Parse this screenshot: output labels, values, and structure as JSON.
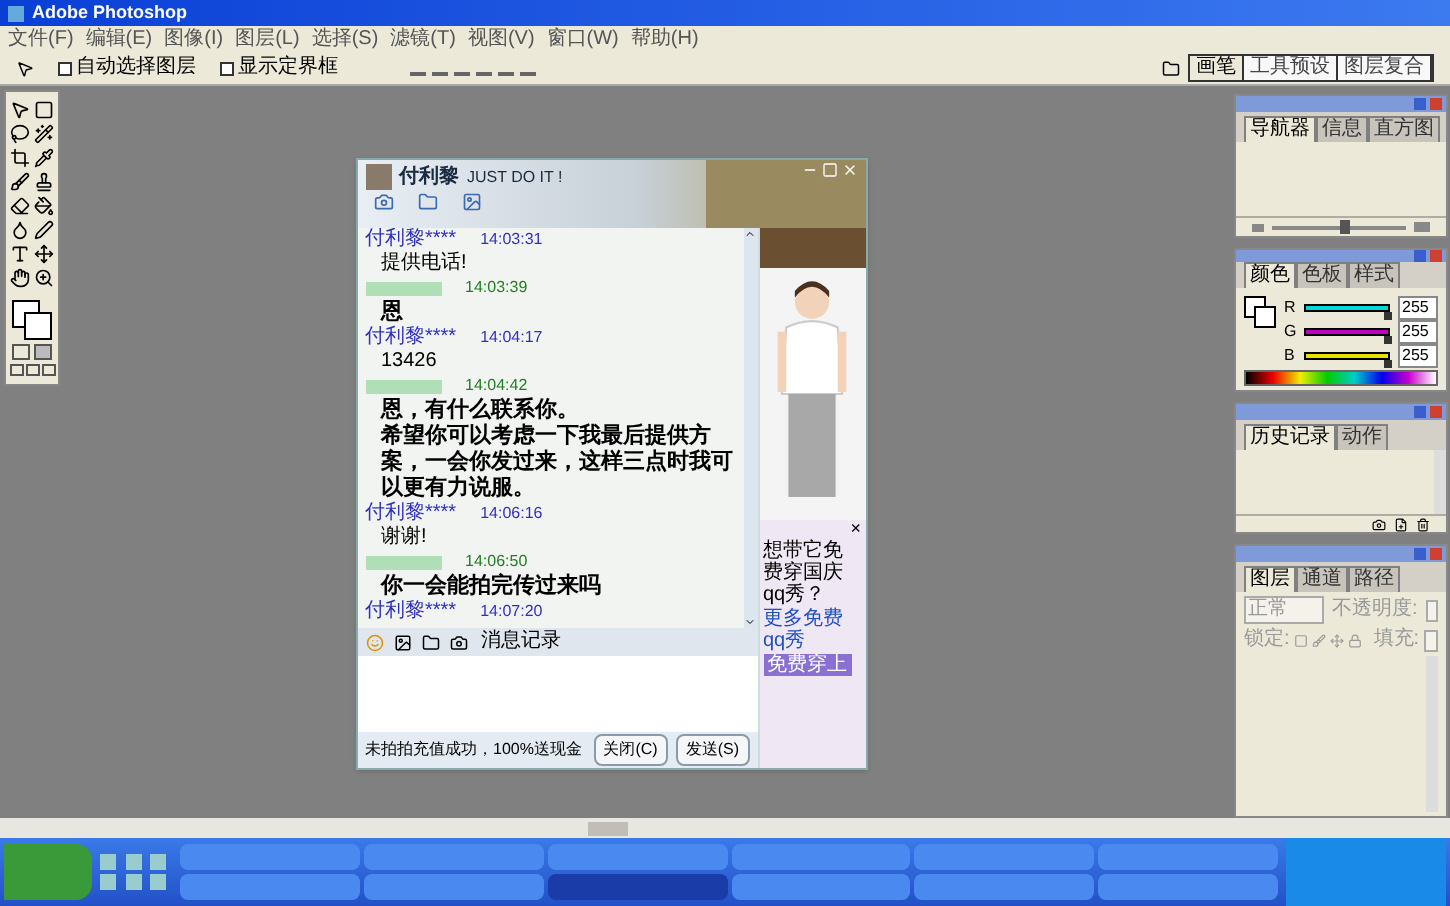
{
  "window": {
    "title": "Adobe Photoshop"
  },
  "menu": [
    "文件(F)",
    "编辑(E)",
    "图像(I)",
    "图层(L)",
    "选择(S)",
    "滤镜(T)",
    "视图(V)",
    "窗口(W)",
    "帮助(H)"
  ],
  "options_bar": {
    "checkboxes": [
      {
        "label": "自动选择图层",
        "checked": false
      },
      {
        "label": "显示定界框",
        "checked": false
      }
    ],
    "palette_tabs": [
      {
        "label": "画笔",
        "selected": true
      },
      {
        "label": "工具预设",
        "selected": false
      },
      {
        "label": "图层复合",
        "selected": false
      }
    ]
  },
  "chat": {
    "contact_name": "付利黎",
    "signature": "JUST DO IT !",
    "messages": [
      {
        "kind": "contact",
        "sender": "付利黎****",
        "time": "14:03:31",
        "lines": [
          "提供电话!"
        ]
      },
      {
        "kind": "self",
        "time": "14:03:39",
        "lines": [
          "恩"
        ]
      },
      {
        "kind": "contact",
        "sender": "付利黎****",
        "time": "14:04:17",
        "lines": [
          "13426"
        ]
      },
      {
        "kind": "self",
        "time": "14:04:42",
        "lines": [
          "恩，有什么联系你。",
          "希望你可以考虑一下我最后提供方案，一会你发过来，这样三点时我可以更有力说服。"
        ]
      },
      {
        "kind": "contact",
        "sender": "付利黎****",
        "time": "14:06:16",
        "lines": [
          "谢谢!"
        ]
      },
      {
        "kind": "self",
        "time": "14:06:50",
        "lines": [
          "你一会能拍完传过来吗"
        ]
      },
      {
        "kind": "contact",
        "sender": "付利黎****",
        "time": "14:07:20"
      }
    ],
    "history_button": "消息记录",
    "status": "未拍拍充值成功，100%送现金",
    "buttons": [
      "关闭(C)",
      "发送(S)"
    ],
    "ad": {
      "close": "×",
      "text": "想带它免费穿国庆qq秀？",
      "link": "更多免费qq秀",
      "button": "免费穿上"
    }
  },
  "panels": [
    {
      "kind": "navigator",
      "tabs": [
        {
          "label": "导航器",
          "selected": true
        },
        {
          "label": "信息",
          "selected": false
        },
        {
          "label": "直方图",
          "selected": false
        }
      ],
      "zoom": {
        "level": 0.55
      }
    },
    {
      "kind": "color",
      "tabs": [
        {
          "label": "颜色",
          "selected": true
        },
        {
          "label": "色板",
          "selected": false
        },
        {
          "label": "样式",
          "selected": false
        }
      ],
      "channels": [
        {
          "name": "R",
          "level": 1,
          "reading": "255"
        },
        {
          "name": "G",
          "level": 1,
          "reading": "255"
        },
        {
          "name": "B",
          "level": 1,
          "reading": "255"
        }
      ]
    },
    {
      "kind": "history",
      "tabs": [
        {
          "label": "历史记录",
          "selected": true
        },
        {
          "label": "动作",
          "selected": false
        }
      ]
    },
    {
      "kind": "layers",
      "tabs": [
        {
          "label": "图层",
          "selected": true
        },
        {
          "label": "通道",
          "selected": false
        },
        {
          "label": "路径",
          "selected": false
        }
      ],
      "blend_mode": "正常",
      "opacity_label": "不透明度:",
      "lock_label": "锁定:",
      "fill_label": "填充:"
    }
  ],
  "taskbar": {
    "items": [
      {
        "selected": false
      },
      {
        "selected": false
      },
      {
        "selected": false
      },
      {
        "selected": false
      },
      {
        "selected": false
      },
      {
        "selected": false
      },
      {
        "selected": false
      },
      {
        "selected": false
      },
      {
        "selected": true
      },
      {
        "selected": false
      },
      {
        "selected": false
      },
      {
        "selected": false
      }
    ]
  }
}
